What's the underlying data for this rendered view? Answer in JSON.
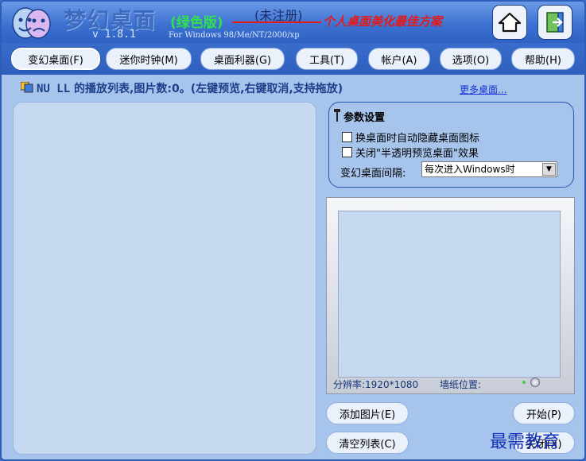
{
  "banner": {
    "app_title": "梦幻桌面",
    "edition": "(绿色版)",
    "unregistered": "(未注册)",
    "slogan": "个人桌面美化最佳方案",
    "version": "v 1.8.1",
    "os_support": "For Windows 98/Me/NT/2000/xp",
    "home_button_icon": "home-icon",
    "exit_button_icon": "exit-door-icon"
  },
  "menu": {
    "items": [
      {
        "label": "变幻桌面(F)",
        "active": true
      },
      {
        "label": "迷你时钟(M)",
        "active": false
      },
      {
        "label": "桌面利器(G)",
        "active": false
      },
      {
        "label": "工具(T)",
        "active": false
      },
      {
        "label": "帐户(A)",
        "active": false
      },
      {
        "label": "选项(O)",
        "active": false
      },
      {
        "label": "帮助(H)",
        "active": false
      }
    ]
  },
  "info": {
    "playlist_name": "NU LL",
    "status_text": "的播放列表,图片数:0。(左键预览,右键取消,支持拖放)",
    "more_link": "更多桌面..."
  },
  "params": {
    "title": "参数设置",
    "options": [
      {
        "label": "换桌面时自动隐藏桌面图标",
        "checked": false
      },
      {
        "label": "关闭\"半透明预览桌面\"效果",
        "checked": false
      }
    ],
    "interval_label": "变幻桌面间隔:",
    "interval_value": "每次进入Windows时"
  },
  "preview": {
    "resolution": "分辨率:1920*1080",
    "wallpaper_position": "墙纸位置:"
  },
  "buttons": {
    "add_image": "添加图片(E)",
    "clear_list": "清空列表(C)",
    "start": "开始(P)",
    "close": "关闭(X)"
  },
  "watermark": "最需教育",
  "colors": {
    "banner_blue": "#3a6fd0",
    "panel_bg": "#a7c4ec",
    "edition_green": "#2fe24c",
    "slogan_red": "#e61818",
    "link_blue": "#1533d6"
  }
}
